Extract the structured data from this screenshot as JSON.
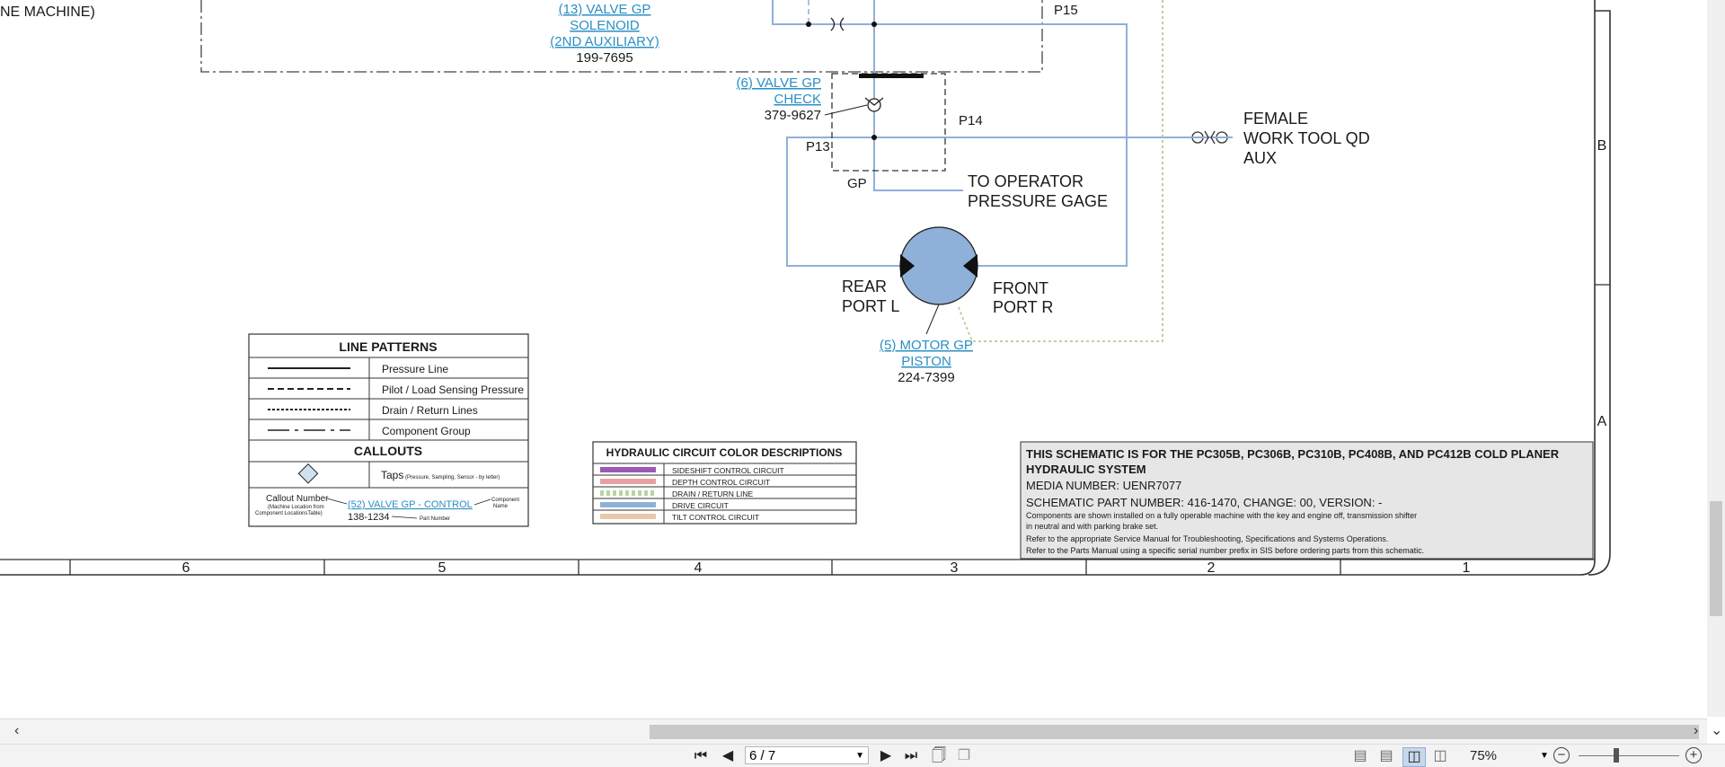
{
  "schematic": {
    "top_left_label": "NE MACHINE)",
    "components": {
      "valve_solenoid": {
        "name_lines": [
          "(13) VALVE GP",
          "SOLENOID",
          "(2ND AUXILIARY)"
        ],
        "part_number": "199-7695"
      },
      "valve_check": {
        "name_lines": [
          "(6) VALVE GP",
          "CHECK"
        ],
        "part_number": "379-9627"
      },
      "motor_piston": {
        "name_lines": [
          "(5) MOTOR GP",
          "PISTON"
        ],
        "part_number": "224-7399"
      }
    },
    "ports": {
      "p15": "P15",
      "p14": "P14",
      "p13": "P13",
      "gp": "GP"
    },
    "labels": {
      "female_qd": [
        "FEMALE",
        "WORK TOOL QD",
        "AUX"
      ],
      "operator_gage": [
        "TO OPERATOR",
        "PRESSURE GAGE"
      ],
      "rear_port": [
        "REAR",
        "PORT L"
      ],
      "front_port": [
        "FRONT",
        "PORT R"
      ]
    },
    "zone_letters": [
      "B",
      "A"
    ],
    "grid_numbers": [
      "6",
      "5",
      "4",
      "3",
      "2",
      "1"
    ],
    "line_patterns": {
      "title": "LINE PATTERNS",
      "rows": [
        "Pressure Line",
        "Pilot / Load Sensing Pressure",
        "Drain / Return Lines",
        "Component Group"
      ],
      "callouts_title": "CALLOUTS",
      "taps_label": "Taps",
      "taps_note": "(Pressure, Sampling, Sensor - by letter)",
      "callout_number_label": "Callout Number",
      "callout_number_note": [
        "(Machine Location from",
        "Component LocationsTable)"
      ],
      "example_link": "(52) VALVE GP - CONTROL",
      "component_name_note": [
        "Component",
        "Name"
      ],
      "example_part": "138-1234",
      "part_number_note": "Part Number"
    },
    "color_descriptions": {
      "title": "HYDRAULIC CIRCUIT COLOR DESCRIPTIONS",
      "rows": [
        {
          "label": "SIDESHIFT CONTROL CIRCUIT",
          "color": "#9b59b6"
        },
        {
          "label": "DEPTH CONTROL CIRCUIT",
          "color": "#e8a0a0"
        },
        {
          "label": "DRAIN / RETURN LINE",
          "color": "#b8d4a0"
        },
        {
          "label": "DRIVE CIRCUIT",
          "color": "#8fb0d8"
        },
        {
          "label": "TILT CONTROL CIRCUIT",
          "color": "#e8c8a8"
        }
      ]
    },
    "title_block": {
      "heading": "THIS SCHEMATIC IS FOR THE PC305B, PC306B, PC310B, PC408B, AND PC412B COLD PLANER",
      "subheading": "HYDRAULIC SYSTEM",
      "media_number": "MEDIA NUMBER: UENR7077",
      "part_number": "SCHEMATIC PART NUMBER: 416-1470, CHANGE: 00, VERSION: -",
      "notes": [
        "Components are shown installed on a fully operable machine with the key and engine off, transmission shifter",
        "in neutral and with parking brake set.",
        "Refer to the appropriate Service Manual for Troubleshooting, Specifications and Systems Operations.",
        "Refer to the Parts Manual using a specific serial number prefix in SIS before ordering parts from this schematic."
      ]
    },
    "colors": {
      "drive": "#8fb0d8",
      "drain": "#b8c99a",
      "motor_fill": "#8fb0d8",
      "link": "#2a8fc4"
    }
  },
  "viewer": {
    "page_indicator": "6 / 7",
    "zoom": "75%",
    "icons": [
      "first-page-icon",
      "previous-page-icon",
      "next-page-icon",
      "last-page-icon",
      "save-page-icon",
      "copy-page-icon",
      "single-page-view-icon",
      "continuous-view-icon",
      "two-page-view-icon",
      "two-page-continuous-icon",
      "zoom-out-icon",
      "zoom-in-icon"
    ]
  }
}
